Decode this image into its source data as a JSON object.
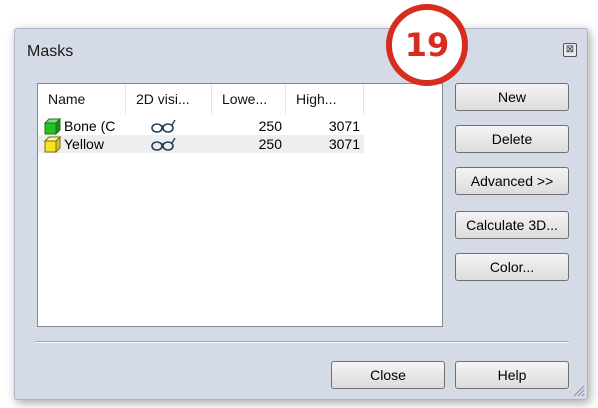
{
  "window": {
    "title": "Masks",
    "close_glyph": "⊠"
  },
  "badge": {
    "number": "19",
    "color": "#d62d20"
  },
  "list": {
    "columns": [
      "Name",
      "2D visi...",
      "Lowe...",
      "High..."
    ],
    "rows": [
      {
        "name": "Bone (C",
        "visible_icon": "glasses-icon",
        "lower": "250",
        "higher": "3071",
        "color": "#22c322"
      },
      {
        "name": "Yellow",
        "visible_icon": "glasses-icon",
        "lower": "250",
        "higher": "3071",
        "color": "#f2e624"
      }
    ]
  },
  "buttons": {
    "new": "New",
    "delete": "Delete",
    "advanced": "Advanced >>",
    "calculate": "Calculate 3D...",
    "color": "Color...",
    "close": "Close",
    "help": "Help"
  }
}
